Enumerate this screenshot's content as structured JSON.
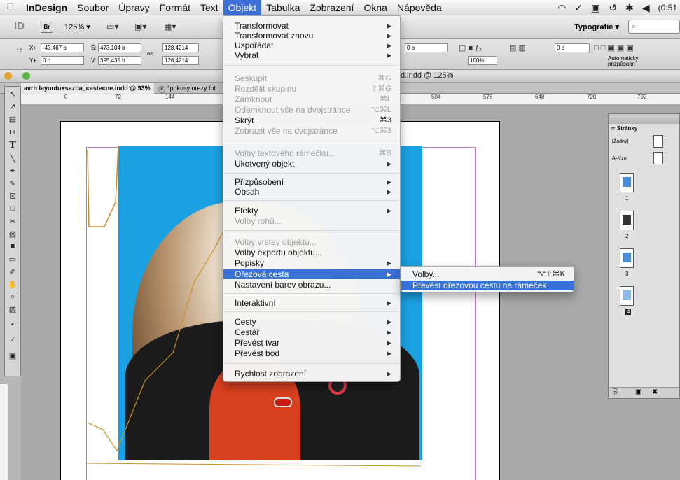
{
  "menubar": {
    "app": "InDesign",
    "items": [
      "Soubor",
      "Úpravy",
      "Formát",
      "Text",
      "Objekt",
      "Tabulka",
      "Zobrazení",
      "Okna",
      "Nápověda"
    ],
    "active": "Objekt",
    "clock": "(0:51"
  },
  "appbar": {
    "logo": "ID",
    "bridge": "Br",
    "zoom": "125% ▾",
    "workspace": "Typografie ▾",
    "search_placeholder": "⌕"
  },
  "control": {
    "x": "-43,467 b",
    "y": "0 b",
    "w": "473,104 b",
    "h": "395,435 b",
    "scale1": "128,4214",
    "scale2": "128,4214",
    "stroke": "0 b",
    "stroke2": "0 b",
    "percent": "100%",
    "autofit": "Automaticky přizpůsobit"
  },
  "document": {
    "window_title": "d.indd @ 125%",
    "tabs": [
      {
        "label": "avrh layoutu+sazba_castecne.indd @ 93%"
      },
      {
        "label": "*pokusy orezy fot"
      }
    ],
    "ruler_ticks": [
      "0",
      "72",
      "144",
      "504",
      "576",
      "648",
      "720",
      "792"
    ]
  },
  "objekt_menu": {
    "items": [
      {
        "label": "Transformovat",
        "shortcut": "",
        "submenu": true,
        "disabled": false
      },
      {
        "label": "Transformovat znovu",
        "shortcut": "",
        "submenu": true,
        "disabled": false
      },
      {
        "label": "Uspořádat",
        "shortcut": "",
        "submenu": true,
        "disabled": false
      },
      {
        "label": "Vybrat",
        "shortcut": "",
        "submenu": true,
        "disabled": false
      },
      {
        "label": "Seskupit",
        "shortcut": "⌘G",
        "submenu": false,
        "disabled": true
      },
      {
        "label": "Rozdělit skupinu",
        "shortcut": "⇧⌘G",
        "submenu": false,
        "disabled": true
      },
      {
        "label": "Zamknout",
        "shortcut": "⌘L",
        "submenu": false,
        "disabled": true
      },
      {
        "label": "Odemknout vše na dvojstránce",
        "shortcut": "⌥⌘L",
        "submenu": false,
        "disabled": true
      },
      {
        "label": "Skrýt",
        "shortcut": "⌘3",
        "submenu": false,
        "disabled": false
      },
      {
        "label": "Zobrazit vše na dvojstránce",
        "shortcut": "⌥⌘3",
        "submenu": false,
        "disabled": true
      },
      {
        "label": "Volby textového rámečku...",
        "shortcut": "⌘B",
        "submenu": false,
        "disabled": true
      },
      {
        "label": "Ukotvený objekt",
        "shortcut": "",
        "submenu": true,
        "disabled": false
      },
      {
        "label": "Přizpůsobení",
        "shortcut": "",
        "submenu": true,
        "disabled": false
      },
      {
        "label": "Obsah",
        "shortcut": "",
        "submenu": true,
        "disabled": false
      },
      {
        "label": "Efekty",
        "shortcut": "",
        "submenu": true,
        "disabled": false
      },
      {
        "label": "Volby rohů...",
        "shortcut": "",
        "submenu": false,
        "disabled": true
      },
      {
        "label": "Volby vrstev objektu...",
        "shortcut": "",
        "submenu": false,
        "disabled": true
      },
      {
        "label": "Volby exportu objektu...",
        "shortcut": "",
        "submenu": false,
        "disabled": false
      },
      {
        "label": "Popisky",
        "shortcut": "",
        "submenu": true,
        "disabled": false
      },
      {
        "label": "Ořezová cesta",
        "shortcut": "",
        "submenu": true,
        "disabled": false,
        "highlighted": true
      },
      {
        "label": "Nastavení barev obrazu...",
        "shortcut": "",
        "submenu": false,
        "disabled": false
      },
      {
        "label": "Interaktivní",
        "shortcut": "",
        "submenu": true,
        "disabled": false
      },
      {
        "label": "Cesty",
        "shortcut": "",
        "submenu": true,
        "disabled": false
      },
      {
        "label": "Cestář",
        "shortcut": "",
        "submenu": true,
        "disabled": false
      },
      {
        "label": "Převést tvar",
        "shortcut": "",
        "submenu": true,
        "disabled": false
      },
      {
        "label": "Převést bod",
        "shortcut": "",
        "submenu": true,
        "disabled": false
      },
      {
        "label": "Rychlost zobrazení",
        "shortcut": "",
        "submenu": true,
        "disabled": false
      }
    ]
  },
  "submenu": {
    "items": [
      {
        "label": "Volby...",
        "shortcut": "⌥⇧⌘K",
        "highlighted": false
      },
      {
        "label": "Převést ořezovou cestu na rámeček",
        "shortcut": "",
        "highlighted": true
      }
    ]
  },
  "pages_panel": {
    "tab": "≑ Stránky",
    "none_label": "[Žádný]",
    "master_label": "A–Vzor",
    "pages": [
      "1",
      "2",
      "3",
      "4"
    ]
  },
  "colors": {
    "menu_highlight": "#3872d6",
    "photo_background": "#1ba1e2",
    "margin_guide": "#c872c8"
  }
}
